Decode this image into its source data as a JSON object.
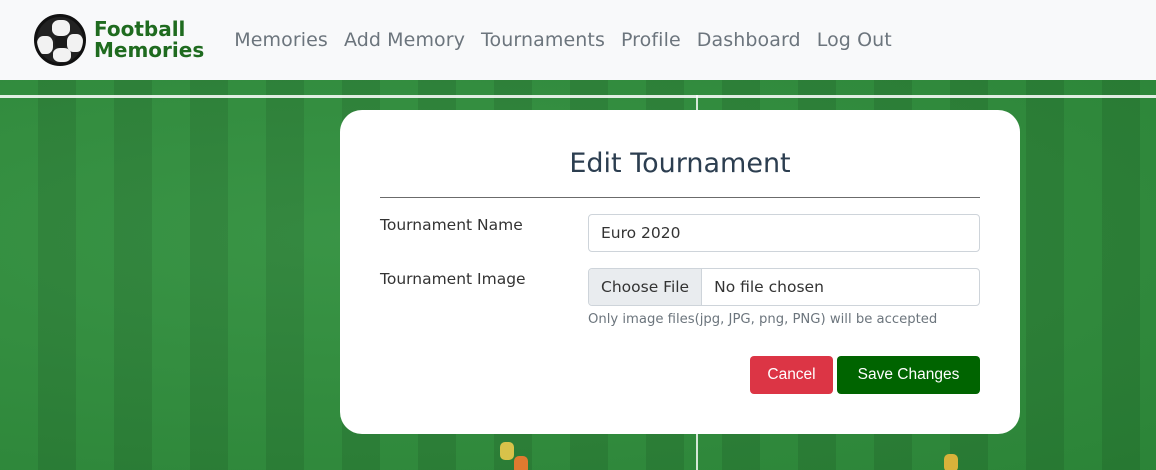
{
  "navbar": {
    "brand_line1": "Football",
    "brand_line2": "Memories",
    "links": [
      "Memories",
      "Add Memory",
      "Tournaments",
      "Profile",
      "Dashboard",
      "Log Out"
    ]
  },
  "form": {
    "title": "Edit Tournament",
    "name_label": "Tournament Name",
    "name_value": "Euro 2020",
    "image_label": "Tournament Image",
    "choose_file_label": "Choose File",
    "file_status": "No file chosen",
    "help_text": "Only image files(jpg, JPG, png, PNG) will be accepted",
    "cancel_label": "Cancel",
    "save_label": "Save Changes"
  },
  "colors": {
    "brand": "#1f6b1f",
    "cancel": "#dc3545",
    "save": "#006400"
  },
  "icons": {
    "logo": "soccer-ball-icon"
  }
}
